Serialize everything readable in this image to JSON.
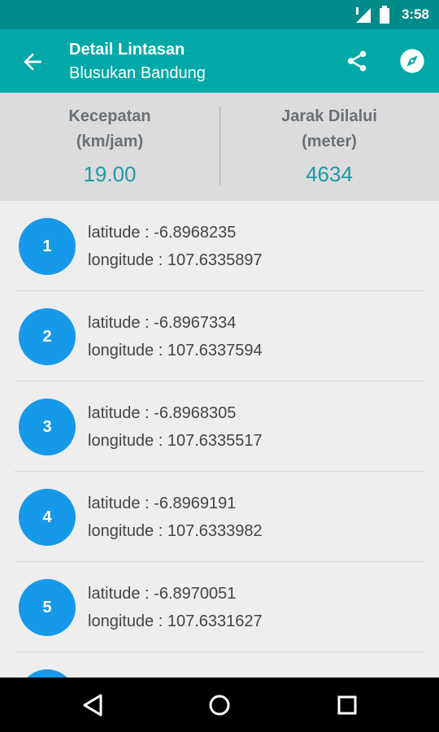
{
  "status": {
    "time": "3:58"
  },
  "appbar": {
    "title": "Detail Lintasan",
    "subtitle": "Blusukan Bandung"
  },
  "stats": {
    "speed": {
      "label_line1": "Kecepatan",
      "label_line2": "(km/jam)",
      "value": "19.00"
    },
    "distance": {
      "label_line1": "Jarak Dilalui",
      "label_line2": "(meter)",
      "value": "4634"
    }
  },
  "points": [
    {
      "number": "1",
      "latitude": "latitude : -6.8968235",
      "longitude": "longitude : 107.6335897"
    },
    {
      "number": "2",
      "latitude": "latitude : -6.8967334",
      "longitude": "longitude : 107.6337594"
    },
    {
      "number": "3",
      "latitude": "latitude : -6.8968305",
      "longitude": "longitude : 107.6335517"
    },
    {
      "number": "4",
      "latitude": "latitude : -6.8969191",
      "longitude": "longitude : 107.6333982"
    },
    {
      "number": "5",
      "latitude": "latitude : -6.8970051",
      "longitude": "longitude : 107.6331627"
    },
    {
      "number": "",
      "latitude": "",
      "longitude": ""
    }
  ],
  "colors": {
    "statusbar": "#008b8b",
    "appbar": "#00a9a7",
    "badge": "#1799ea",
    "value": "#1e9aa6"
  }
}
